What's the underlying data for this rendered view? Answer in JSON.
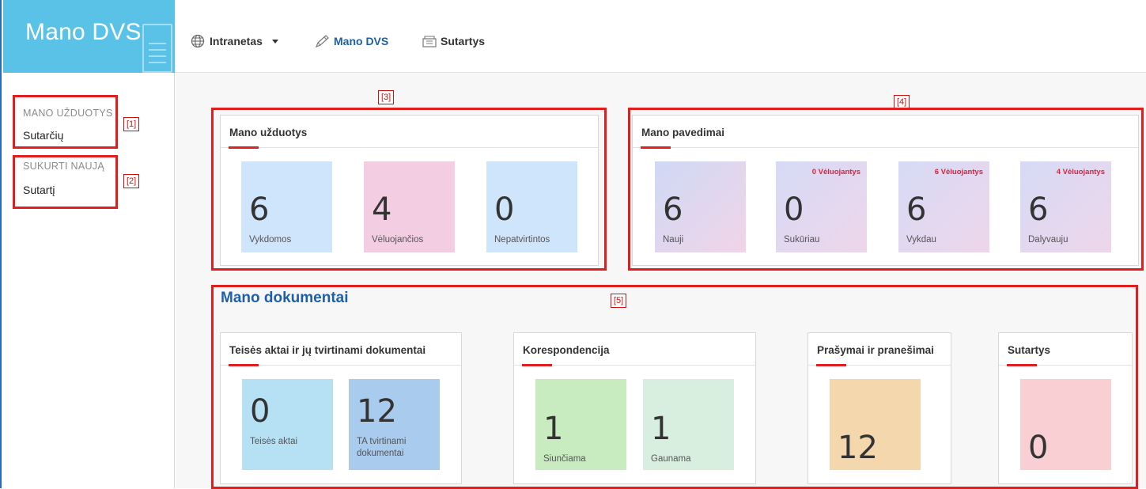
{
  "app": {
    "title": "Mano DVS"
  },
  "nav": {
    "intranet": "Intranetas",
    "mano_dvs": "Mano DVS",
    "sutartys": "Sutartys"
  },
  "sidebar": {
    "tasks_heading": "MANO UŽDUOTYS",
    "tasks_item": "Sutarčių",
    "create_heading": "SUKURTI NAUJĄ",
    "create_item": "Sutartį"
  },
  "tags": {
    "t1": "[1]",
    "t2": "[2]",
    "t3": "[3]",
    "t4": "[4]",
    "t5": "[5]"
  },
  "tasks": {
    "title": "Mano užduotys",
    "tiles": [
      {
        "value": "6",
        "label": "Vykdomos",
        "color": "#cfe5fb"
      },
      {
        "value": "4",
        "label": "Vėluojančios",
        "color": "#f3cde1"
      },
      {
        "value": "0",
        "label": "Nepatvirtintos",
        "color": "#cfe5fb"
      }
    ]
  },
  "assignments": {
    "title": "Mano pavedimai",
    "tiles": [
      {
        "value": "6",
        "label": "Nauji",
        "late": ""
      },
      {
        "value": "0",
        "label": "Sukūriau",
        "late": "0 Vėluojantys"
      },
      {
        "value": "6",
        "label": "Vykdau",
        "late": "6 Vėluojantys"
      },
      {
        "value": "6",
        "label": "Dalyvauju",
        "late": "4 Vėluojantys"
      }
    ]
  },
  "documents": {
    "title": "Mano dokumentai",
    "legal": {
      "title": "Teisės aktai ir jų tvirtinami dokumentai",
      "tiles": [
        {
          "value": "0",
          "label": "Teisės aktai",
          "color": "#b6e1f4"
        },
        {
          "value": "12",
          "label": "TA tvirtinami dokumentai",
          "color": "#a9cbee"
        }
      ]
    },
    "correspondence": {
      "title": "Korespondencija",
      "tiles": [
        {
          "value": "1",
          "label": "Siunčiama",
          "color": "#c8ecc0"
        },
        {
          "value": "1",
          "label": "Gaunama",
          "color": "#d8eedf"
        }
      ]
    },
    "requests": {
      "title": "Prašymai ir pranešimai",
      "tiles": [
        {
          "value": "12",
          "label": "",
          "color": "#f4d7ac"
        }
      ]
    },
    "contracts": {
      "title": "Sutartys",
      "tiles": [
        {
          "value": "0",
          "label": "",
          "color": "#f9cfd3"
        }
      ]
    }
  },
  "colors": {
    "accent": "#1f5fa8",
    "brand": "#5bc2e7",
    "highlight": "#e01e1e"
  }
}
